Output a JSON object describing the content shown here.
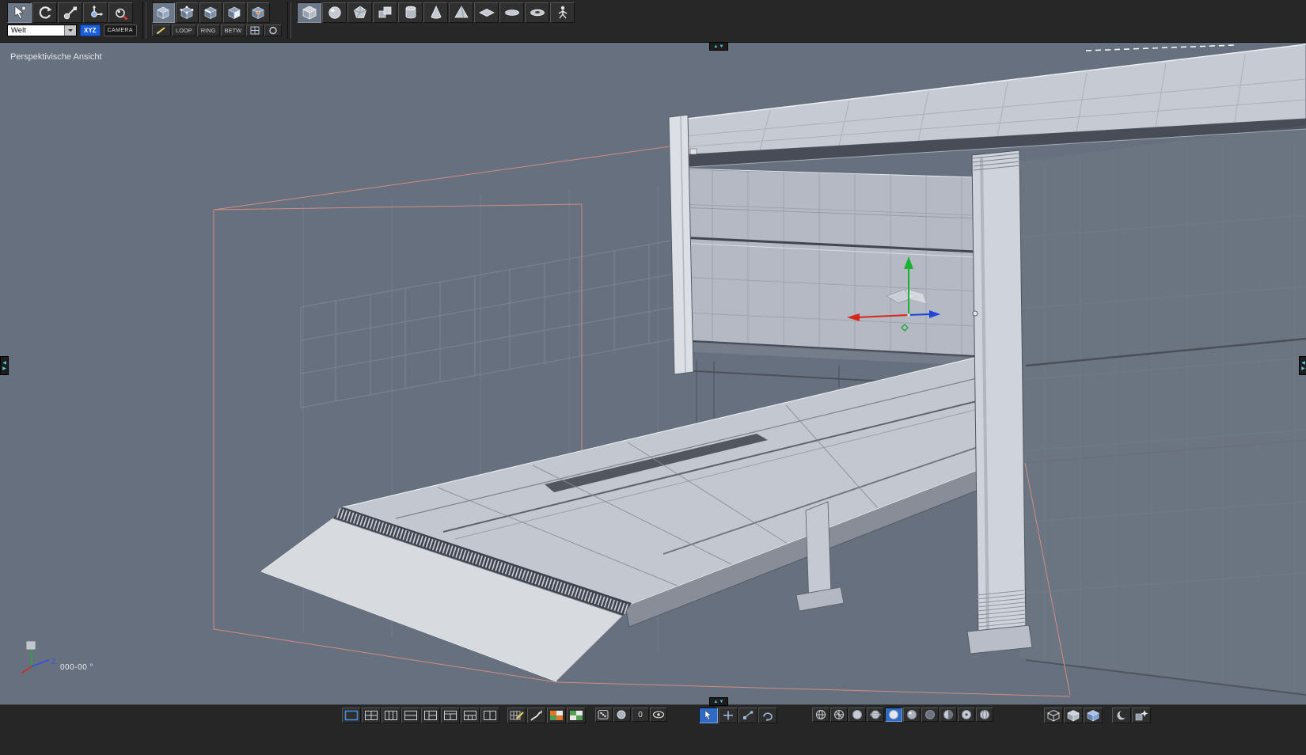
{
  "viewport": {
    "label": "Perspektivische Ansicht",
    "axis_readout": "000-00 °",
    "axis_z_label": "Z"
  },
  "top_toolbar": {
    "coordinate_system": {
      "value": "Welt"
    },
    "xyz_label": "XYZ",
    "camera_label": "CAMERA",
    "loop_label": "LOOP",
    "ring_label": "RING",
    "betw_label": "BETW",
    "tools": [
      "live-selection",
      "rotate",
      "scale",
      "move",
      "zoom"
    ],
    "mode_buttons": [
      "model",
      "points",
      "edges",
      "polygons",
      "texture-axis"
    ],
    "primitive_buttons": [
      "cube",
      "sphere",
      "polyhedron",
      "array",
      "cylinder",
      "cone",
      "pyramid",
      "plane",
      "disc",
      "torus",
      "figure"
    ]
  },
  "bottom_toolbar": {
    "zero_label": "0",
    "layout_buttons": [
      "single-view",
      "quad-view",
      "three-column",
      "two-row",
      "left-split",
      "top-split",
      "bottom-split",
      "two-column"
    ],
    "edit_buttons": [
      "uv-edit",
      "paint",
      "material-grid",
      "texture-grid"
    ],
    "display_buttons": [
      "dice",
      "sphere",
      "zero",
      "eye"
    ],
    "tool_buttons": [
      "live-selection",
      "move",
      "scale",
      "rotate"
    ],
    "shading_buttons": [
      "wire-globe",
      "axis-globe",
      "flat-sphere",
      "ring-sphere",
      "active-sphere",
      "shaded-sphere",
      "dark-sphere",
      "half-sphere",
      "dot-sphere",
      "line-sphere"
    ],
    "cube_buttons": [
      "wire-cube",
      "shaded-cube",
      "blue-cube"
    ],
    "extra_buttons": [
      "moon",
      "sparkle-cube"
    ]
  },
  "colors": {
    "viewport_background": "#67707e",
    "toolbar_background": "#262626",
    "selection_blue": "#1d5fd8",
    "grid_line": "#8f95a1",
    "world_box": "#dc9180",
    "axis_x_red": "#d42a1e",
    "axis_y_green": "#1fae38",
    "axis_z_blue": "#1e45d6"
  }
}
